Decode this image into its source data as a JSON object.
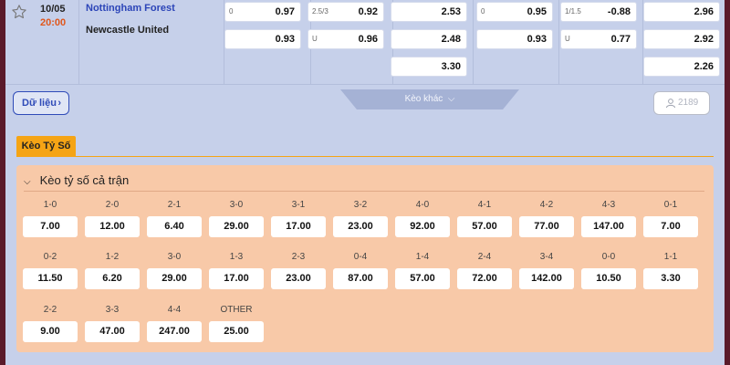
{
  "match": {
    "date": "10/05",
    "time": "20:00",
    "home": "Nottingham Forest",
    "away": "Newcastle United",
    "markets": [
      {
        "hc": "0",
        "value": "0.97"
      },
      {
        "hc": "",
        "value": "0.93"
      },
      {
        "hc": "2.5/3",
        "value": "0.92"
      },
      {
        "hc": "U",
        "value": "0.96"
      },
      {
        "hc": "",
        "value": "2.53"
      },
      {
        "hc": "",
        "value": "2.48"
      },
      {
        "hc": "",
        "value": "3.30"
      },
      {
        "hc": "0",
        "value": "0.95"
      },
      {
        "hc": "",
        "value": "0.93"
      },
      {
        "hc": "1/1.5",
        "value": "-0.88"
      },
      {
        "hc": "U",
        "value": "0.77"
      },
      {
        "hc": "",
        "value": "2.96"
      },
      {
        "hc": "",
        "value": "2.92"
      },
      {
        "hc": "",
        "value": "2.26"
      }
    ]
  },
  "toolbar": {
    "data_label": "Dữ liệu",
    "more_label": "Kèo khác",
    "viewers": "2189"
  },
  "tabs": [
    {
      "label": "Kèo Tỷ Số",
      "active": true
    }
  ],
  "panel": {
    "title": "Kèo tỷ số cả trận",
    "rows": [
      [
        {
          "score": "1-0",
          "odd": "7.00"
        },
        {
          "score": "2-0",
          "odd": "12.00"
        },
        {
          "score": "2-1",
          "odd": "6.40"
        },
        {
          "score": "3-0",
          "odd": "29.00"
        },
        {
          "score": "3-1",
          "odd": "17.00"
        },
        {
          "score": "3-2",
          "odd": "23.00"
        },
        {
          "score": "4-0",
          "odd": "92.00"
        },
        {
          "score": "4-1",
          "odd": "57.00"
        },
        {
          "score": "4-2",
          "odd": "77.00"
        },
        {
          "score": "4-3",
          "odd": "147.00"
        },
        {
          "score": "0-1",
          "odd": "7.00"
        }
      ],
      [
        {
          "score": "0-2",
          "odd": "11.50"
        },
        {
          "score": "1-2",
          "odd": "6.20"
        },
        {
          "score": "3-0",
          "odd": "29.00"
        },
        {
          "score": "1-3",
          "odd": "17.00"
        },
        {
          "score": "2-3",
          "odd": "23.00"
        },
        {
          "score": "0-4",
          "odd": "87.00"
        },
        {
          "score": "1-4",
          "odd": "57.00"
        },
        {
          "score": "2-4",
          "odd": "72.00"
        },
        {
          "score": "3-4",
          "odd": "142.00"
        },
        {
          "score": "0-0",
          "odd": "10.50"
        },
        {
          "score": "1-1",
          "odd": "3.30"
        }
      ],
      [
        {
          "score": "2-2",
          "odd": "9.00"
        },
        {
          "score": "3-3",
          "odd": "47.00"
        },
        {
          "score": "4-4",
          "odd": "247.00"
        },
        {
          "score": "OTHER",
          "odd": "25.00"
        }
      ]
    ]
  },
  "colors": {
    "accent": "#f5a415",
    "home_team": "#2c45b8",
    "time": "#e0561b",
    "panel_bg": "#f8c9a8",
    "page_bg": "#c6d0ea"
  }
}
